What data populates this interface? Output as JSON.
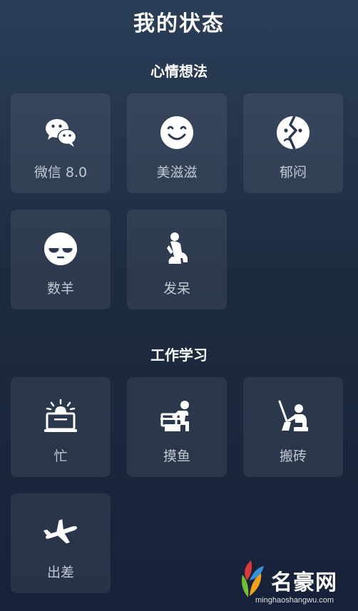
{
  "header": {
    "title": "我的状态"
  },
  "sections": [
    {
      "title": "心情想法",
      "items": [
        {
          "label": "微信 8.0",
          "icon": "wechat-icon"
        },
        {
          "label": "美滋滋",
          "icon": "smile-face-icon"
        },
        {
          "label": "郁闷",
          "icon": "broken-heart-face-icon"
        },
        {
          "label": "数羊",
          "icon": "sleepy-face-icon"
        },
        {
          "label": "发呆",
          "icon": "thinker-icon"
        }
      ]
    },
    {
      "title": "工作学习",
      "items": [
        {
          "label": "忙",
          "icon": "alarm-laptop-icon"
        },
        {
          "label": "摸鱼",
          "icon": "desk-worker-icon"
        },
        {
          "label": "搬砖",
          "icon": "shovel-worker-icon"
        },
        {
          "label": "出差",
          "icon": "airplane-icon"
        }
      ]
    }
  ],
  "watermark": {
    "name": "名豪网",
    "url": "minghaoshangwu.com"
  }
}
